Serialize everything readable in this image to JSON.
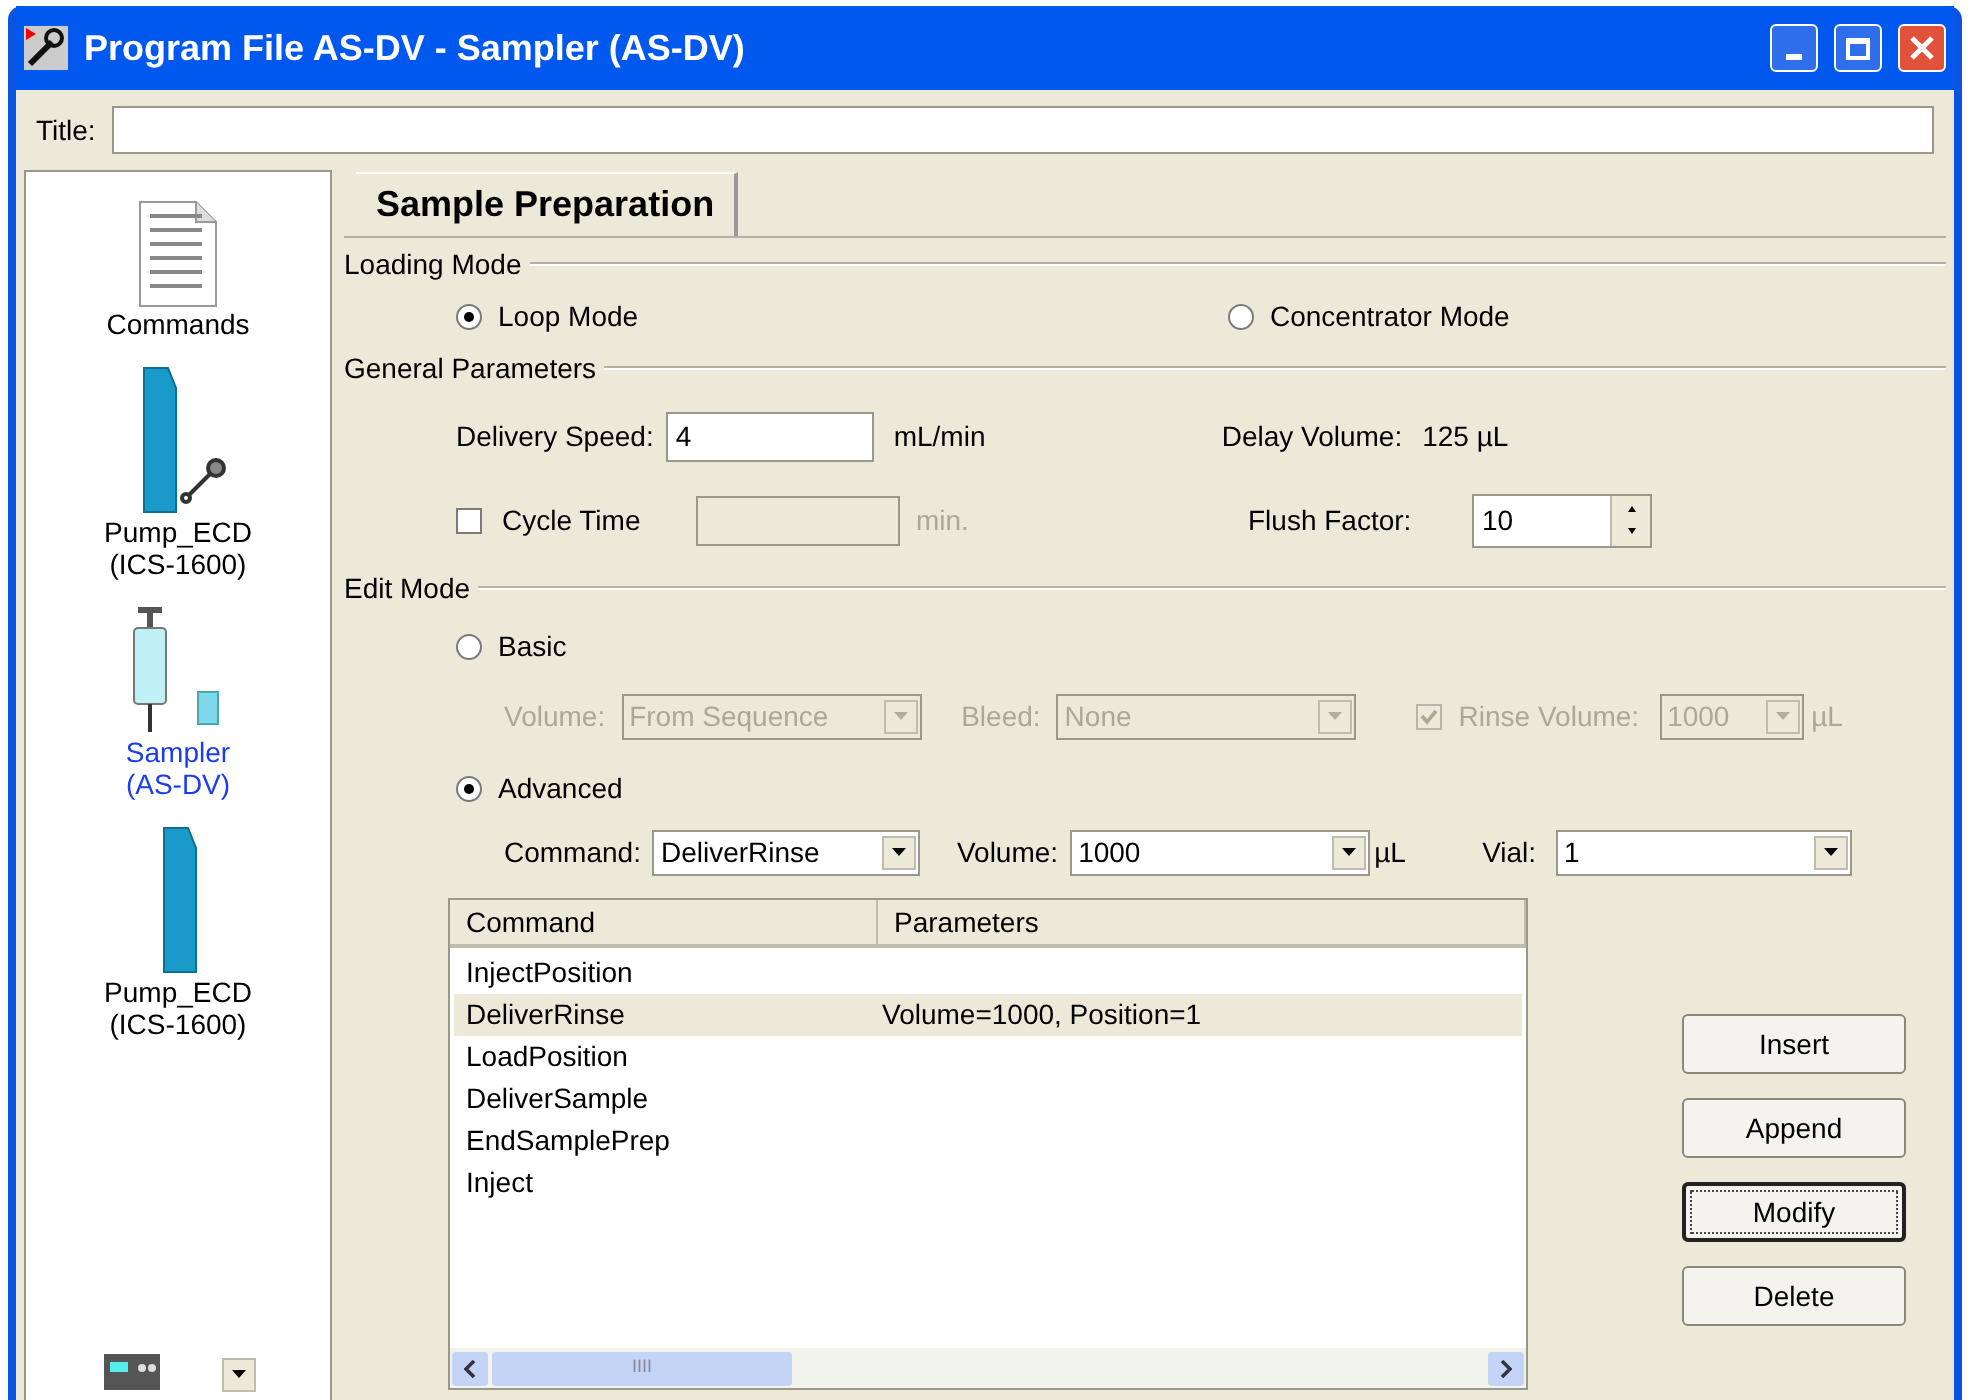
{
  "window": {
    "title": "Program File AS-DV - Sampler (AS-DV)"
  },
  "title_field": {
    "label": "Title:"
  },
  "sidebar": {
    "items": [
      {
        "kind": "commands",
        "lines": [
          "Commands"
        ],
        "selected": false
      },
      {
        "kind": "pump",
        "lines": [
          "Pump_ECD",
          "(ICS-1600)"
        ],
        "selected": false
      },
      {
        "kind": "sampler",
        "lines": [
          "Sampler",
          "(AS-DV)"
        ],
        "selected": true
      },
      {
        "kind": "pump2",
        "lines": [
          "Pump_ECD",
          "(ICS-1600)"
        ],
        "selected": false
      }
    ]
  },
  "tabs": [
    {
      "label": "Sample Preparation",
      "selected": true
    }
  ],
  "loading_mode": {
    "heading": "Loading Mode",
    "options": [
      {
        "label": "Loop Mode",
        "selected": true
      },
      {
        "label": "Concentrator Mode",
        "selected": false
      }
    ]
  },
  "general": {
    "heading": "General Parameters",
    "delivery_speed": {
      "label": "Delivery Speed:",
      "value": "4",
      "unit": "mL/min"
    },
    "delay_volume": {
      "label": "Delay Volume:",
      "value": "125 µL"
    },
    "cycle_time": {
      "label": "Cycle Time",
      "checked": false,
      "unit": "min."
    },
    "flush_factor": {
      "label": "Flush Factor:",
      "value": "10"
    }
  },
  "edit_mode": {
    "heading": "Edit Mode",
    "basic": {
      "label": "Basic",
      "selected": false,
      "volume_label": "Volume:",
      "volume": "From Sequence",
      "bleed_label": "Bleed:",
      "bleed": "None",
      "rinse_label": "Rinse Volume:",
      "rinse_checked": true,
      "rinse_value": "1000",
      "rinse_unit": "µL"
    },
    "advanced": {
      "label": "Advanced",
      "selected": true,
      "command_label": "Command:",
      "command": "DeliverRinse",
      "volume_label": "Volume:",
      "volume": "1000",
      "volume_unit": "µL",
      "vial_label": "Vial:",
      "vial": "1"
    }
  },
  "table": {
    "columns": [
      "Command",
      "Parameters"
    ],
    "rows": [
      {
        "command": "InjectPosition",
        "selected": false
      },
      {
        "command": "DeliverRinse",
        "parameters": "Volume=1000, Position=1",
        "selected": true
      },
      {
        "command": "LoadPosition",
        "selected": false
      },
      {
        "command": "DeliverSample",
        "selected": false
      },
      {
        "command": "EndSamplePrep",
        "selected": false
      },
      {
        "command": "Inject",
        "selected": false
      }
    ],
    "scroll_grip": "IIII"
  },
  "buttons": [
    {
      "label": "Insert",
      "focused": false
    },
    {
      "label": "Append",
      "focused": false
    },
    {
      "label": "Modify",
      "focused": true
    },
    {
      "label": "Delete",
      "focused": false
    }
  ]
}
